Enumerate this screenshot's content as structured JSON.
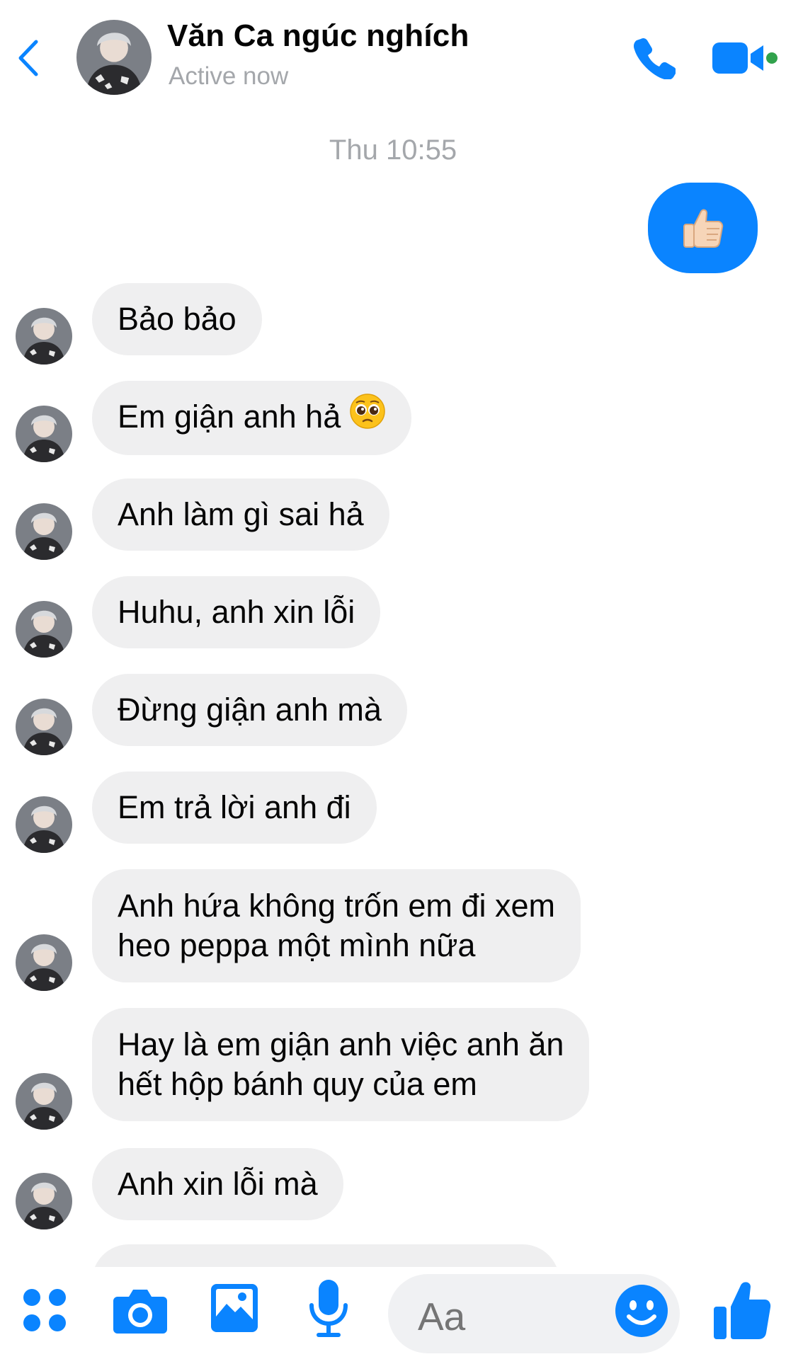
{
  "header": {
    "contact_name": "Văn Ca ngúc nghích",
    "status": "Active now",
    "icons": {
      "back": "chevron-left-icon",
      "call": "phone-icon",
      "video": "video-camera-icon"
    },
    "accent_color": "#0a84ff",
    "online_color": "#31a24c"
  },
  "timestamp": "Thu 10:55",
  "outgoing": {
    "type": "thumbs-up",
    "bubble_color": "#0a84ff"
  },
  "messages": [
    {
      "text": "Bảo bảo"
    },
    {
      "text": "Em giận anh hả",
      "emoji": "pleading-face"
    },
    {
      "text": "Anh làm gì sai hả"
    },
    {
      "text": "Huhu, anh xin lỗi"
    },
    {
      "text": "Đừng giận anh mà"
    },
    {
      "text": "Em trả lời anh đi"
    },
    {
      "line1": "Anh hứa không trốn em đi xem",
      "line2": "heo peppa một mình nữa"
    },
    {
      "line1": "Hay là em giận anh việc anh ăn",
      "line2": "hết hộp bánh quy của em"
    },
    {
      "text": "Anh xin lỗi mà"
    }
  ],
  "composer": {
    "placeholder": "Aa",
    "icons": [
      "apps-grid-icon",
      "camera-icon",
      "gallery-icon",
      "microphone-icon",
      "emoji-icon",
      "thumbs-up-icon"
    ]
  }
}
